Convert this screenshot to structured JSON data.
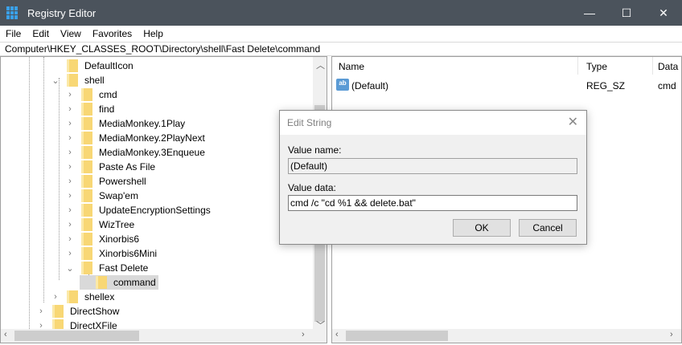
{
  "window": {
    "title": "Registry Editor",
    "minimize": "—",
    "maximize": "☐",
    "close": "✕"
  },
  "menu": [
    "File",
    "Edit",
    "View",
    "Favorites",
    "Help"
  ],
  "address": "Computer\\HKEY_CLASSES_ROOT\\Directory\\shell\\Fast Delete\\command",
  "tree": [
    {
      "label": "DefaultIcon",
      "depth": 3,
      "expander": "none"
    },
    {
      "label": "shell",
      "depth": 3,
      "expander": "expanded"
    },
    {
      "label": "cmd",
      "depth": 4,
      "expander": "collapsed"
    },
    {
      "label": "find",
      "depth": 4,
      "expander": "collapsed"
    },
    {
      "label": "MediaMonkey.1Play",
      "depth": 4,
      "expander": "collapsed"
    },
    {
      "label": "MediaMonkey.2PlayNext",
      "depth": 4,
      "expander": "collapsed"
    },
    {
      "label": "MediaMonkey.3Enqueue",
      "depth": 4,
      "expander": "collapsed"
    },
    {
      "label": "Paste As File",
      "depth": 4,
      "expander": "collapsed"
    },
    {
      "label": "Powershell",
      "depth": 4,
      "expander": "collapsed"
    },
    {
      "label": "Swap'em",
      "depth": 4,
      "expander": "collapsed"
    },
    {
      "label": "UpdateEncryptionSettings",
      "depth": 4,
      "expander": "collapsed"
    },
    {
      "label": "WizTree",
      "depth": 4,
      "expander": "collapsed"
    },
    {
      "label": "Xinorbis6",
      "depth": 4,
      "expander": "collapsed"
    },
    {
      "label": "Xinorbis6Mini",
      "depth": 4,
      "expander": "collapsed"
    },
    {
      "label": "Fast Delete",
      "depth": 4,
      "expander": "expanded"
    },
    {
      "label": "command",
      "depth": 5,
      "expander": "none",
      "selected": true
    },
    {
      "label": "shellex",
      "depth": 3,
      "expander": "collapsed"
    },
    {
      "label": "DirectShow",
      "depth": 2,
      "expander": "collapsed"
    },
    {
      "label": "DirectXFile",
      "depth": 2,
      "expander": "collapsed"
    }
  ],
  "list": {
    "columns": [
      "Name",
      "Type",
      "Data"
    ],
    "rows": [
      {
        "icon": "ab",
        "name": "(Default)",
        "type": "REG_SZ",
        "data": "cmd"
      }
    ]
  },
  "dialog": {
    "title": "Edit String",
    "value_name_label": "Value name:",
    "value_name": "(Default)",
    "value_data_label": "Value data:",
    "value_data": "cmd /c \"cd %1 && delete.bat\"",
    "ok": "OK",
    "cancel": "Cancel"
  }
}
